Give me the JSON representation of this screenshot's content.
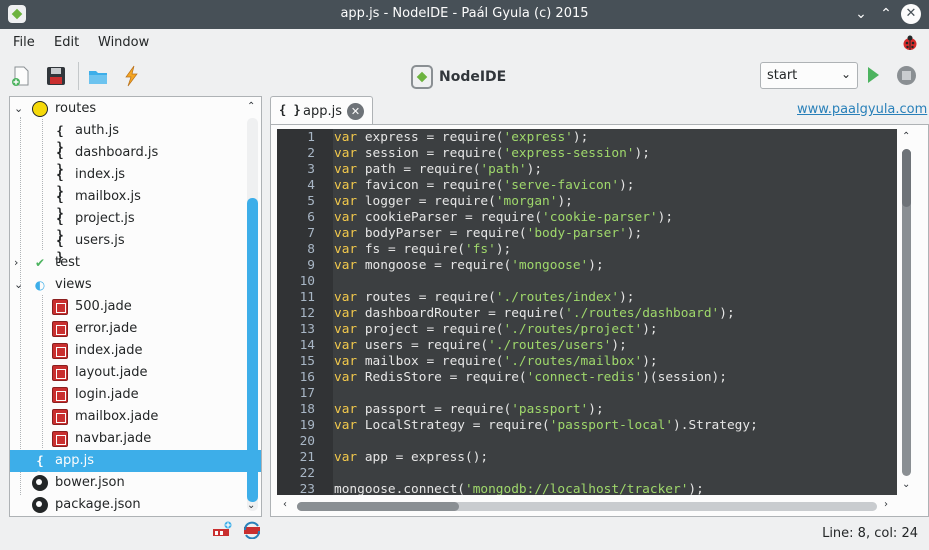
{
  "window": {
    "title": "app.js - NodeIDE - Paál Gyula (c) 2015",
    "controls": {
      "minimize": "⌄",
      "maximize": "⌃",
      "close": "✕"
    }
  },
  "menu": {
    "items": [
      "File",
      "Edit",
      "Window"
    ]
  },
  "toolbar": {
    "brand": "NodeIDE",
    "icons": [
      "new-file-icon",
      "save-icon",
      "open-folder-icon",
      "lightning-icon"
    ],
    "script_select": {
      "value": "start",
      "arrow": "⌄"
    },
    "run_icon": "play-icon",
    "stop_icon": "stop-icon",
    "bug_icon": "ladybug-icon",
    "colors": {
      "run": "#4cb35f",
      "selection": "#3daee9"
    }
  },
  "tree": {
    "items": [
      {
        "label": "routes",
        "type": "folder-routes",
        "expanded": true
      },
      {
        "label": "auth.js",
        "type": "json"
      },
      {
        "label": "dashboard.js",
        "type": "json"
      },
      {
        "label": "index.js",
        "type": "json"
      },
      {
        "label": "mailbox.js",
        "type": "json"
      },
      {
        "label": "project.js",
        "type": "json"
      },
      {
        "label": "users.js",
        "type": "json"
      },
      {
        "label": "test",
        "type": "folder-test",
        "expanded": false
      },
      {
        "label": "views",
        "type": "folder-views",
        "expanded": true
      },
      {
        "label": "500.jade",
        "type": "jade"
      },
      {
        "label": "error.jade",
        "type": "jade"
      },
      {
        "label": "index.jade",
        "type": "jade"
      },
      {
        "label": "layout.jade",
        "type": "jade"
      },
      {
        "label": "login.jade",
        "type": "jade"
      },
      {
        "label": "mailbox.jade",
        "type": "jade"
      },
      {
        "label": "navbar.jade",
        "type": "jade"
      },
      {
        "label": "app.js",
        "type": "json",
        "selected": true
      },
      {
        "label": "bower.json",
        "type": "dot"
      },
      {
        "label": "package.json",
        "type": "dot"
      }
    ],
    "json_glyph": "{ }",
    "bottom_icons": [
      "npm-add-icon",
      "npm-refresh-icon"
    ]
  },
  "tabs": [
    {
      "glyph": "{ }",
      "label": "app.js",
      "close": "✕"
    }
  ],
  "site_link": "www.paalgyula.com",
  "editor": {
    "lines": [
      {
        "n": "1",
        "kw": "var",
        "pre": " express = require(",
        "str": "'express'",
        "post": ");"
      },
      {
        "n": "2",
        "kw": "var",
        "pre": " session = require(",
        "str": "'express-session'",
        "post": ");"
      },
      {
        "n": "3",
        "kw": "var",
        "pre": " path = require(",
        "str": "'path'",
        "post": ");"
      },
      {
        "n": "4",
        "kw": "var",
        "pre": " favicon = require(",
        "str": "'serve-favicon'",
        "post": ");"
      },
      {
        "n": "5",
        "kw": "var",
        "pre": " logger = require(",
        "str": "'morgan'",
        "post": ");"
      },
      {
        "n": "6",
        "kw": "var",
        "pre": " cookieParser = require(",
        "str": "'cookie-parser'",
        "post": ");"
      },
      {
        "n": "7",
        "kw": "var",
        "pre": " bodyParser = require(",
        "str": "'body-parser'",
        "post": ");"
      },
      {
        "n": "8",
        "kw": "var",
        "pre": " fs = require(",
        "str": "'fs'",
        "post": ");"
      },
      {
        "n": "9",
        "kw": "var",
        "pre": " mongoose = require(",
        "str": "'mongoose'",
        "post": ");"
      },
      {
        "n": "10",
        "kw": "",
        "pre": "",
        "str": "",
        "post": ""
      },
      {
        "n": "11",
        "kw": "var",
        "pre": " routes = require(",
        "str": "'./routes/index'",
        "post": ");"
      },
      {
        "n": "12",
        "kw": "var",
        "pre": " dashboardRouter = require(",
        "str": "'./routes/dashboard'",
        "post": ");"
      },
      {
        "n": "13",
        "kw": "var",
        "pre": " project = require(",
        "str": "'./routes/project'",
        "post": ");"
      },
      {
        "n": "14",
        "kw": "var",
        "pre": " users = require(",
        "str": "'./routes/users'",
        "post": ");"
      },
      {
        "n": "15",
        "kw": "var",
        "pre": " mailbox = require(",
        "str": "'./routes/mailbox'",
        "post": ");"
      },
      {
        "n": "16",
        "kw": "var",
        "pre": " RedisStore = require(",
        "str": "'connect-redis'",
        "post": ")(session);"
      },
      {
        "n": "17",
        "kw": "",
        "pre": "",
        "str": "",
        "post": ""
      },
      {
        "n": "18",
        "kw": "var",
        "pre": " passport = require(",
        "str": "'passport'",
        "post": ");"
      },
      {
        "n": "19",
        "kw": "var",
        "pre": " LocalStrategy = require(",
        "str": "'passport-local'",
        "post": ").Strategy;"
      },
      {
        "n": "20",
        "kw": "",
        "pre": "",
        "str": "",
        "post": ""
      },
      {
        "n": "21",
        "kw": "var",
        "pre": " app = express();",
        "str": "",
        "post": ""
      },
      {
        "n": "22",
        "kw": "",
        "pre": "",
        "str": "",
        "post": ""
      },
      {
        "n": "23",
        "kw": "",
        "pre": "mongoose.connect(",
        "str": "'mongodb://localhost/tracker'",
        "post": ");"
      }
    ]
  },
  "status": {
    "cursor": "Line: 8, col: 24"
  }
}
